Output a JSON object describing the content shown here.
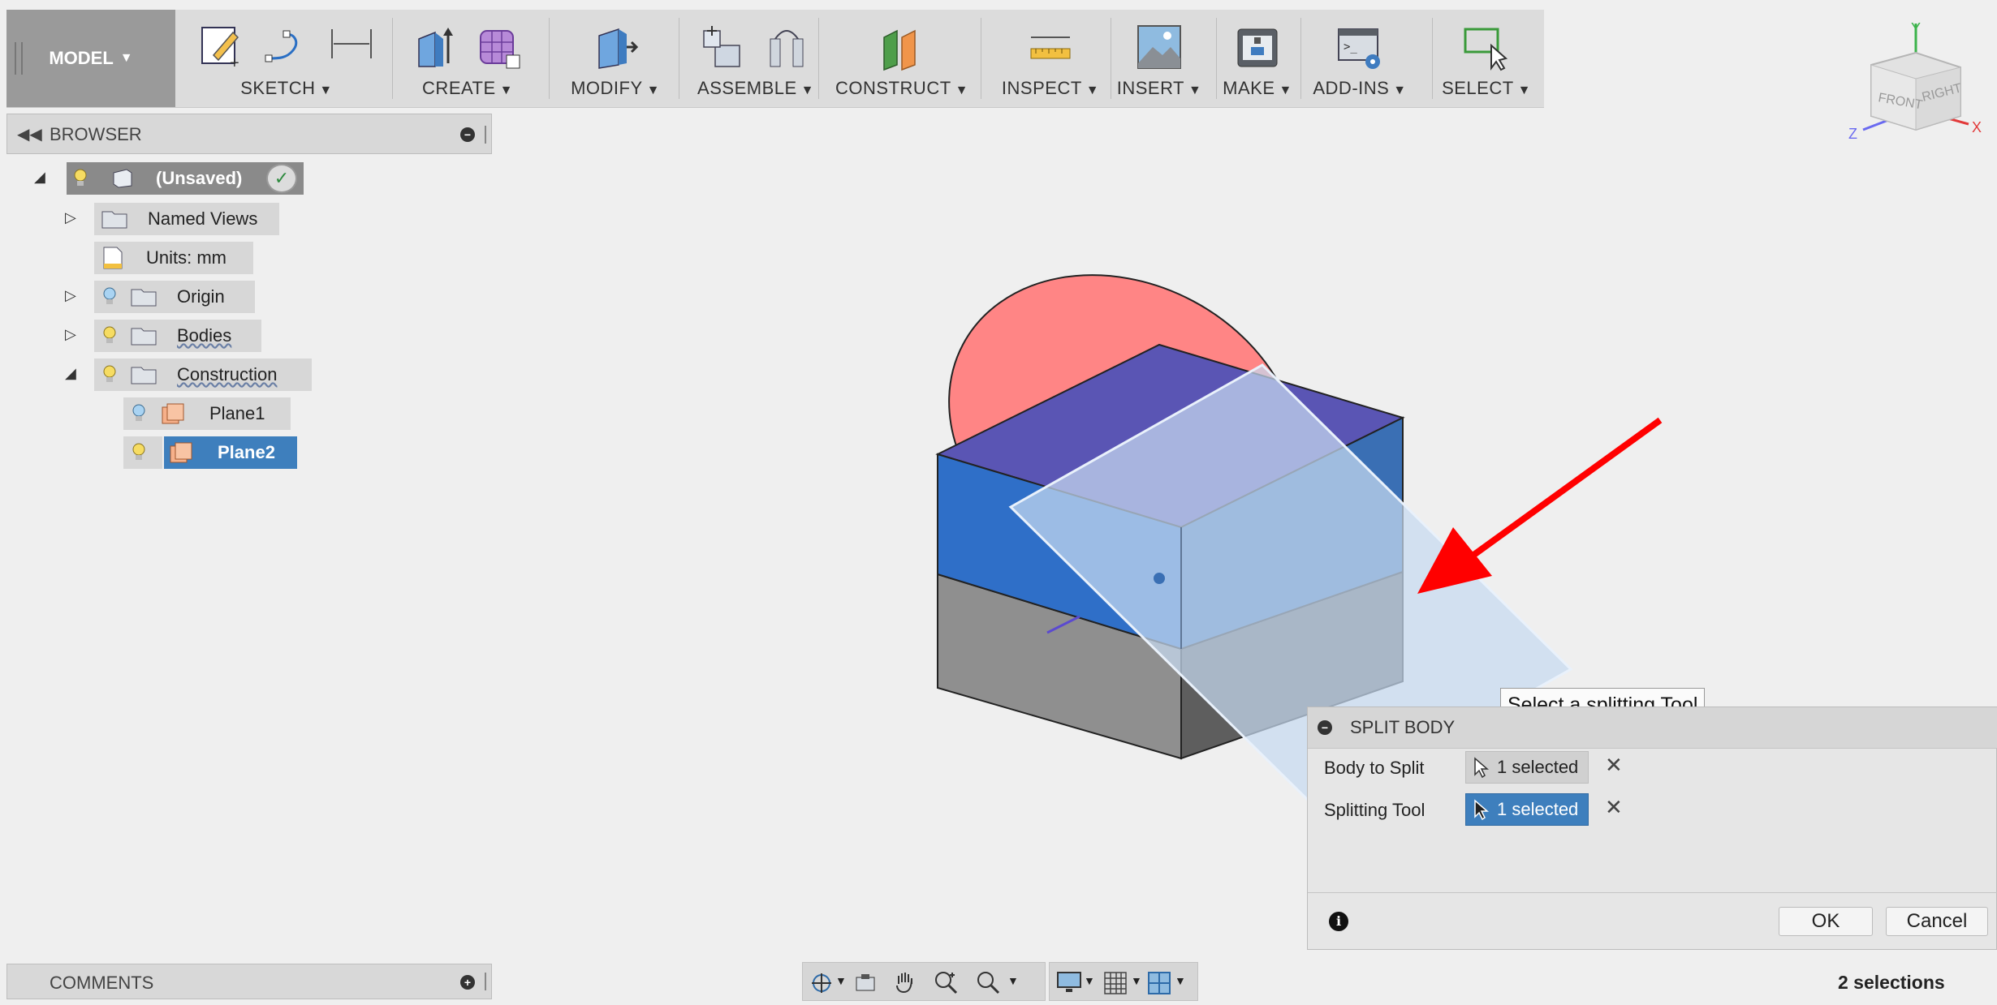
{
  "toolbar": {
    "workspace": "MODEL",
    "groups": [
      {
        "label": "SKETCH"
      },
      {
        "label": "CREATE"
      },
      {
        "label": "MODIFY"
      },
      {
        "label": "ASSEMBLE"
      },
      {
        "label": "CONSTRUCT"
      },
      {
        "label": "INSPECT"
      },
      {
        "label": "INSERT"
      },
      {
        "label": "MAKE"
      },
      {
        "label": "ADD-INS"
      },
      {
        "label": "SELECT"
      }
    ]
  },
  "browser": {
    "title": "BROWSER",
    "root": "(Unsaved)",
    "items": [
      {
        "label": "Named Views"
      },
      {
        "label": "Units: mm"
      },
      {
        "label": "Origin"
      },
      {
        "label": "Bodies"
      },
      {
        "label": "Construction"
      },
      {
        "label": "Plane1"
      },
      {
        "label": "Plane2"
      }
    ]
  },
  "viewcube": {
    "front": "FRONT",
    "right": "RIGHT",
    "x": "X",
    "y": "Y",
    "z": "Z"
  },
  "tooltip": "Select a splitting Tool",
  "split_body": {
    "title": "SPLIT BODY",
    "body_label": "Body to Split",
    "body_value": "1 selected",
    "tool_label": "Splitting Tool",
    "tool_value": "1 selected",
    "ok": "OK",
    "cancel": "Cancel"
  },
  "comments": {
    "title": "COMMENTS"
  },
  "status": {
    "selections": "2 selections"
  },
  "colors": {
    "accent": "#3e7fbd",
    "arrow": "#ff0000",
    "body_blue": "#2f6fc8",
    "plane_red": "#ff8585"
  }
}
